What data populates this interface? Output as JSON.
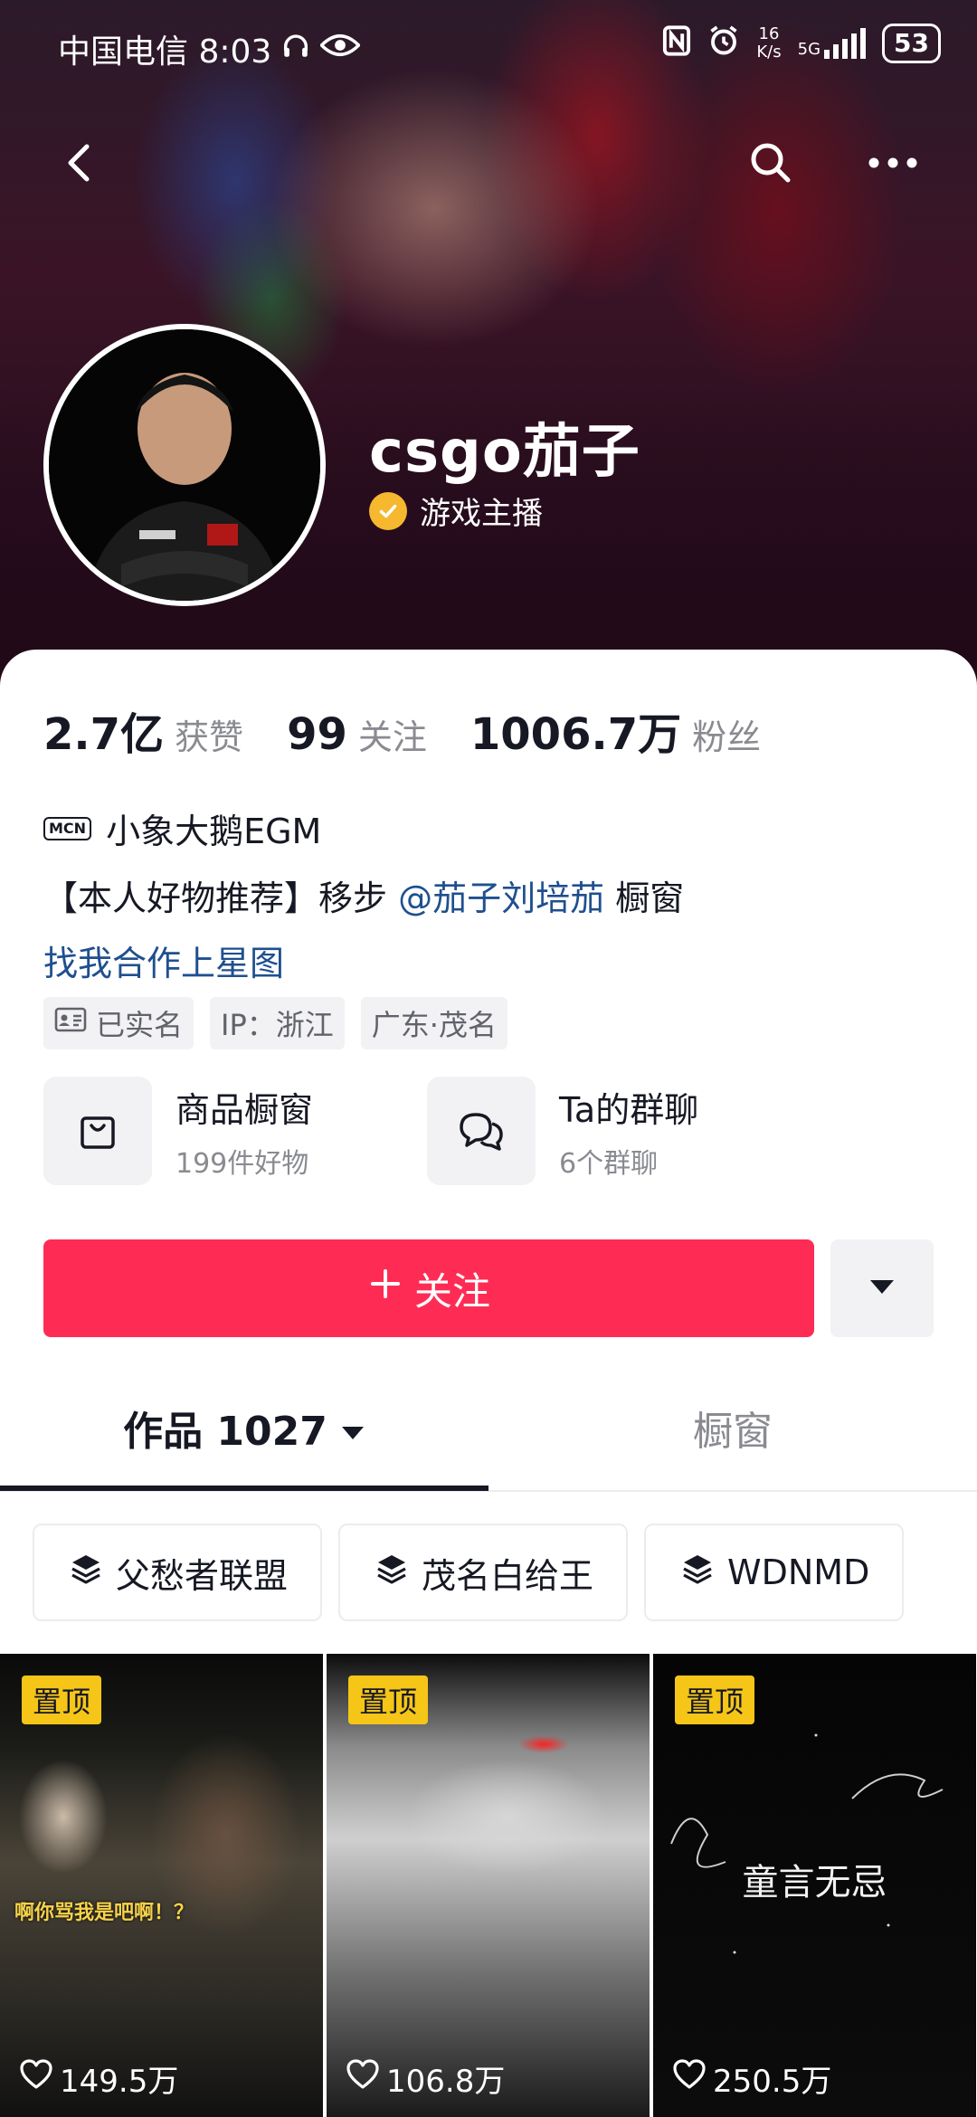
{
  "status_bar": {
    "carrier_time": "中国电信 8:03",
    "net_speed_value": "16",
    "net_speed_unit": "K/s",
    "network": "5G",
    "battery": "53"
  },
  "profile": {
    "name": "csgo茄子",
    "verification": "游戏主播"
  },
  "stats": [
    {
      "value": "2.7亿",
      "label": "获赞"
    },
    {
      "value": "99",
      "label": "关注"
    },
    {
      "value": "1006.7万",
      "label": "粉丝"
    }
  ],
  "bio": {
    "mcn_badge": "MCN",
    "mcn_name": "小象大鹅EGM",
    "line1_prefix": "【本人好物推荐】移步 ",
    "line1_mention": "@茄子刘培茄",
    "line1_suffix": "  橱窗",
    "line2_link": "找我合作上星图"
  },
  "tags": [
    {
      "label": "已实名",
      "icon": "id-card-icon"
    },
    {
      "label": "IP：浙江"
    },
    {
      "label": "广东·茂名"
    }
  ],
  "entries": [
    {
      "title": "商品橱窗",
      "subtitle": "199件好物",
      "icon": "shopping-bag-icon"
    },
    {
      "title": "Ta的群聊",
      "subtitle": "6个群聊",
      "icon": "chat-bubbles-icon"
    }
  ],
  "actions": {
    "follow_label": "关注",
    "more_icon": "caret-down-icon"
  },
  "tabs": {
    "works_label": "作品 1027",
    "shop_label": "橱窗"
  },
  "collections": [
    {
      "label": "父愁者联盟",
      "icon": "layers-icon"
    },
    {
      "label": "茂名白给王",
      "icon": "layers-icon"
    },
    {
      "label": "WDNMD",
      "icon": "layers-icon"
    }
  ],
  "videos": [
    {
      "pin": "置顶",
      "caption": "啊你骂我是吧啊！？",
      "likes": "149.5万"
    },
    {
      "pin": "置顶",
      "caption": "",
      "likes": "106.8万"
    },
    {
      "pin": "置顶",
      "caption": "童言无忌",
      "likes": "250.5万"
    }
  ],
  "colors": {
    "accent": "#fe2c55",
    "link": "#1f4f8f",
    "pin_badge": "#f5c518",
    "verify_badge": "#f5b82e"
  }
}
